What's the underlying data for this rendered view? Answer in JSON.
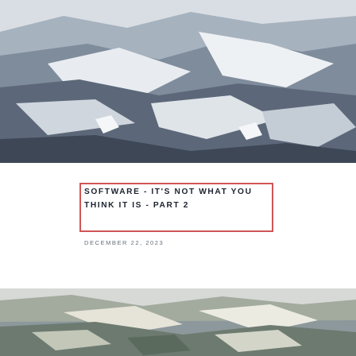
{
  "posts": [
    {
      "image": "desert-landscape-painting",
      "title": "Software - it's not what you think it is - Part 2",
      "date": "December 22, 2023"
    },
    {
      "image": "rocky-terrain-painting"
    }
  ],
  "colors": {
    "title_border": "#cf5555",
    "title_text": "#1d2330",
    "date_text": "#67707d"
  }
}
